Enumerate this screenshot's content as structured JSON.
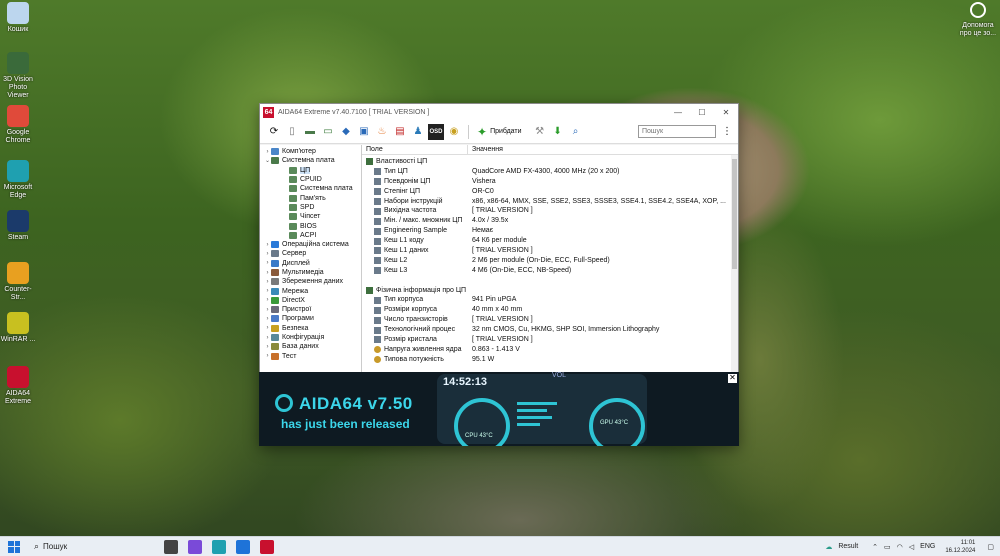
{
  "desktop": {
    "icons": [
      {
        "label": "Кошик",
        "icon": "recycle-bin-icon",
        "color": "#bcd6ee"
      },
      {
        "label": "3D Vision Photo Viewer",
        "icon": "3d-vision-icon",
        "color": "#3a6a3a"
      },
      {
        "label": "Google Chrome",
        "icon": "chrome-icon",
        "color": "#e04a3a"
      },
      {
        "label": "Microsoft Edge",
        "icon": "edge-icon",
        "color": "#1fa0b0"
      },
      {
        "label": "Steam",
        "icon": "steam-icon",
        "color": "#1b3a6a"
      },
      {
        "label": "Counter-Str...",
        "icon": "csgo-icon",
        "color": "#e8a020"
      },
      {
        "label": "WinRAR ...",
        "icon": "winrar-icon",
        "color": "#c8c020"
      },
      {
        "label": "AIDA64 Extreme",
        "icon": "aida64-icon",
        "color": "#c8102e"
      }
    ],
    "help": "Допомога про це зо..."
  },
  "window": {
    "app_icon": "64",
    "title": "AIDA64 Extreme v7.40.7100  [ TRIAL VERSION ]",
    "controls": {
      "minimize": "—",
      "maximize": "☐",
      "close": "✕"
    },
    "toolbar": {
      "report": "Прибдати",
      "search_placeholder": "Пошук"
    },
    "tree": [
      {
        "label": "Комп'ютер",
        "level": 0,
        "exp": "›",
        "color": "#4a86c8"
      },
      {
        "label": "Системна плата",
        "level": 0,
        "exp": "⌄",
        "color": "#4a7a4a"
      },
      {
        "label": "ЦП",
        "level": 1,
        "exp": "",
        "color": "#5a8a5a",
        "selected": true
      },
      {
        "label": "CPUID",
        "level": 1,
        "exp": "",
        "color": "#5a8a5a"
      },
      {
        "label": "Системна плата",
        "level": 1,
        "exp": "",
        "color": "#5a8a5a"
      },
      {
        "label": "Пам'ять",
        "level": 1,
        "exp": "",
        "color": "#5a8a5a"
      },
      {
        "label": "SPD",
        "level": 1,
        "exp": "",
        "color": "#5a8a5a"
      },
      {
        "label": "Чіпсет",
        "level": 1,
        "exp": "",
        "color": "#5a8a5a"
      },
      {
        "label": "BIOS",
        "level": 1,
        "exp": "",
        "color": "#5a8a5a"
      },
      {
        "label": "ACPI",
        "level": 1,
        "exp": "",
        "color": "#5a8a5a"
      },
      {
        "label": "Операційна система",
        "level": 0,
        "exp": "›",
        "color": "#2a7ad8"
      },
      {
        "label": "Сервер",
        "level": 0,
        "exp": "›",
        "color": "#6a7a8a"
      },
      {
        "label": "Дисплей",
        "level": 0,
        "exp": "›",
        "color": "#3a7ac8"
      },
      {
        "label": "Мультимедіа",
        "level": 0,
        "exp": "›",
        "color": "#8a5a3a"
      },
      {
        "label": "Збереження даних",
        "level": 0,
        "exp": "›",
        "color": "#7a7a7a"
      },
      {
        "label": "Мережа",
        "level": 0,
        "exp": "›",
        "color": "#3a8ab8"
      },
      {
        "label": "DirectX",
        "level": 0,
        "exp": "›",
        "color": "#3a9a3a"
      },
      {
        "label": "Пристрої",
        "level": 0,
        "exp": "›",
        "color": "#6a6a7a"
      },
      {
        "label": "Програми",
        "level": 0,
        "exp": "›",
        "color": "#4a7ac8"
      },
      {
        "label": "Безпека",
        "level": 0,
        "exp": "›",
        "color": "#c8a020"
      },
      {
        "label": "Конфігурація",
        "level": 0,
        "exp": "›",
        "color": "#5a8a9a"
      },
      {
        "label": "База даних",
        "level": 0,
        "exp": "›",
        "color": "#8a8a3a"
      },
      {
        "label": "Тест",
        "level": 0,
        "exp": "›",
        "color": "#c8702a"
      }
    ],
    "columns": {
      "field": "Поле",
      "value": "Значення"
    },
    "rows": [
      {
        "field": "Властивості ЦП",
        "value": "",
        "kind": "section"
      },
      {
        "field": "Тип ЦП",
        "value": "QuadCore AMD FX-4300, 4000 MHz (20 x 200)",
        "kind": "item"
      },
      {
        "field": "Псевдонім ЦП",
        "value": "Vishera",
        "kind": "item"
      },
      {
        "field": "Степінг ЦП",
        "value": "OR-C0",
        "kind": "item"
      },
      {
        "field": "Набори інструкцій",
        "value": "x86, x86-64, MMX, SSE, SSE2, SSE3, SSSE3, SSE4.1, SSE4.2, SSE4A, XOP, ...",
        "kind": "item"
      },
      {
        "field": "Вихідна частота",
        "value": "[ TRIAL VERSION ]",
        "kind": "item"
      },
      {
        "field": "Мін. / макс. множник ЦП",
        "value": "4.0x / 39.5x",
        "kind": "item"
      },
      {
        "field": "Engineering Sample",
        "value": "Немає",
        "kind": "item"
      },
      {
        "field": "Кеш L1 коду",
        "value": "64 К6 per module",
        "kind": "item"
      },
      {
        "field": "Кеш L1 даних",
        "value": "[ TRIAL VERSION ]",
        "kind": "item"
      },
      {
        "field": "Кеш L2",
        "value": "2 М6 per module  (On-Die, ECC, Full-Speed)",
        "kind": "item"
      },
      {
        "field": "Кеш L3",
        "value": "4 М6  (On-Die, ECC, NB-Speed)",
        "kind": "item"
      },
      {
        "field": "",
        "value": "",
        "kind": "blank"
      },
      {
        "field": "Фізична інформація про ЦП",
        "value": "",
        "kind": "section"
      },
      {
        "field": "Тип корпуса",
        "value": "941 Pin uPGA",
        "kind": "item"
      },
      {
        "field": "Розміри корпуса",
        "value": "40 mm x 40 mm",
        "kind": "item"
      },
      {
        "field": "Число транзисторів",
        "value": "[ TRIAL VERSION ]",
        "kind": "item"
      },
      {
        "field": "Технологічний процес",
        "value": "32 nm CMOS, Cu, HKMG, SHP SOI, Immersion Lithography",
        "kind": "item"
      },
      {
        "field": "Розмір кристала",
        "value": "[ TRIAL VERSION ]",
        "kind": "item"
      },
      {
        "field": "Напруга живлення ядра",
        "value": "0.863 - 1.413 V",
        "kind": "power"
      },
      {
        "field": "Типова потужність",
        "value": "95.1 W",
        "kind": "power"
      }
    ]
  },
  "banner": {
    "close": "✕",
    "headline": "AIDA64 v7.50",
    "subline": "has just been released",
    "time": "14:52:13",
    "vol": "VOL",
    "gauge1": "CPU 43°C",
    "gauge2": "GPU 43°C",
    "accent": "#3cd6ea"
  },
  "taskbar": {
    "search": "Пошук",
    "weather": "Result",
    "lang": "ENG",
    "time": "11:01",
    "date": "16.12.2024",
    "pinned": [
      {
        "name": "taskview-icon",
        "color": "#444"
      },
      {
        "name": "copilot-icon",
        "color": "#7a4ad8"
      },
      {
        "name": "edge-icon",
        "color": "#1fa0b0"
      },
      {
        "name": "mail-icon",
        "color": "#1e73d8"
      },
      {
        "name": "aida64-icon",
        "color": "#c8102e"
      }
    ]
  }
}
